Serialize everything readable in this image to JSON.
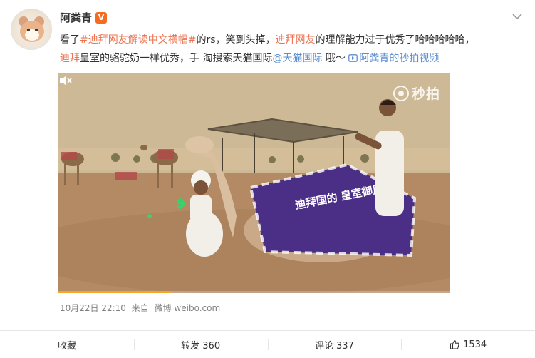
{
  "user": {
    "name": "阿粪青",
    "badge": "V"
  },
  "post": {
    "parts": [
      "看了",
      "#迪拜网友解读中文横幅#",
      "的rs，笑到头掉，",
      "迪拜网友",
      "的理解能力过于优秀了哈哈哈哈哈，",
      "迪拜",
      "皇室的骆驼奶一样优秀，手 淘搜索天猫国际",
      "@天猫国际",
      " 哦～ ",
      "阿粪青的秒拍视频"
    ]
  },
  "video": {
    "watermark": "秒拍",
    "banner_text": "迪拜国的 皇室御用",
    "progress": 0.29,
    "colors": {
      "banner": "#4b2f87",
      "progress": "#f5a623"
    }
  },
  "meta": {
    "date": "10月22日 22:10",
    "from_label": "来自",
    "source": "微博 weibo.com"
  },
  "actions": {
    "favorite": "收藏",
    "repost": "转发 360",
    "comment": "评论 337",
    "like_count": "1534"
  },
  "icons": [
    "vip-icon",
    "chevron-down-icon",
    "miaopai-icon",
    "video-icon",
    "mute-icon",
    "thumb-up-icon"
  ]
}
